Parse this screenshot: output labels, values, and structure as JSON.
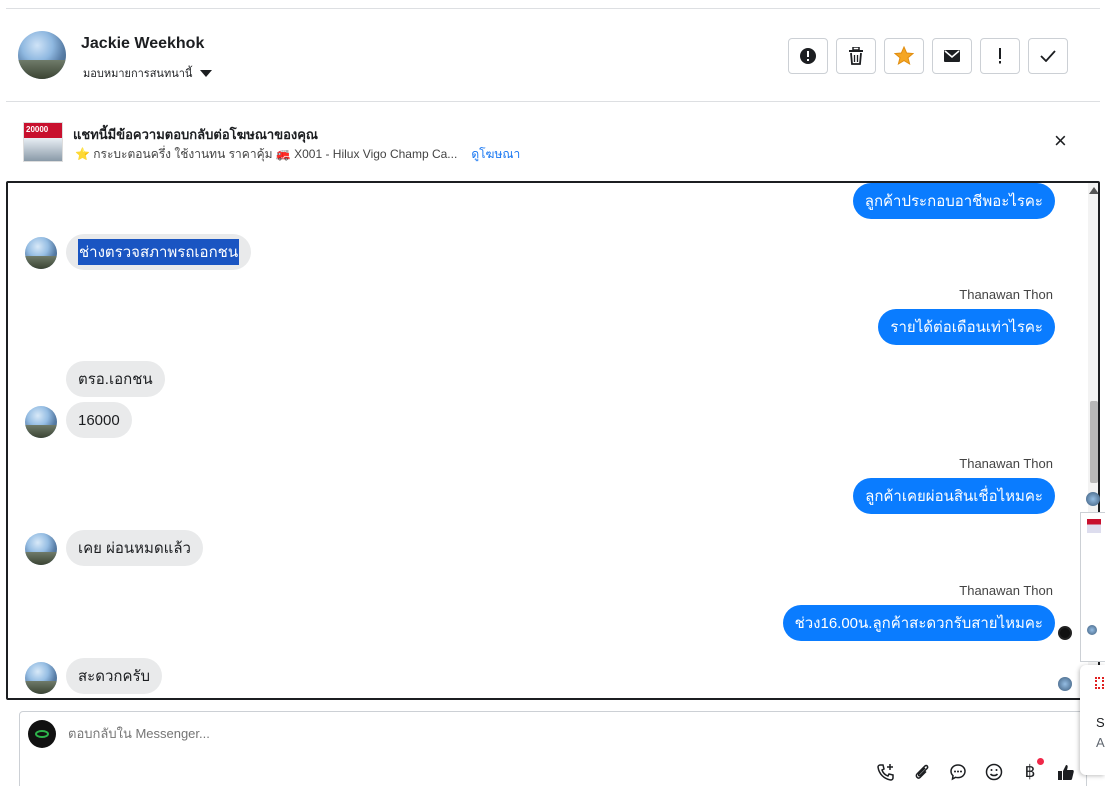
{
  "header": {
    "name": "Jackie Weekhok",
    "assign_label": "มอบหมายการสนทนานี้",
    "actions": [
      "!",
      "🗑",
      "★",
      "✉",
      "!",
      "✓"
    ]
  },
  "ad": {
    "thumb_text": "20000",
    "title": "แชทนี้มีข้อความตอบกลับต่อโฆษณาของคุณ",
    "subtitle": "⭐ กระบะตอนครึ่ง ใช้งานทน ราคาคุ้ม 🚒 X001 - Hilux Vigo Champ Ca...",
    "link": "ดูโฆษณา",
    "close": "×"
  },
  "messages": {
    "m1": "ลูกค้าประกอบอาชีพอะไรคะ",
    "m2": "ช่างตรวจสภาพรถเอกชน",
    "m3_sender": "Thanawan Thon",
    "m3": "รายได้ต่อเดือนเท่าไรคะ",
    "m4": "ตรอ.เอกชน",
    "m5": "16000",
    "m6_sender": "Thanawan Thon",
    "m6": "ลูกค้าเคยผ่อนสินเชื่อไหมคะ",
    "m7": "เคย ผ่อนหมดแล้ว",
    "m8_sender": "Thanawan Thon",
    "m8": "ช่วง16.00น.ลูกค้าสะดวกรับสายไหมคะ",
    "m9": "สะดวกครับ"
  },
  "composer": {
    "placeholder": "ตอบกลับใน Messenger..."
  },
  "peek": {
    "t1": "Sc",
    "t2": "A"
  },
  "colors": {
    "outgoing": "#0a7cff",
    "incoming": "#e9eaeb",
    "link": "#1877f2",
    "star": "#f5a623"
  }
}
